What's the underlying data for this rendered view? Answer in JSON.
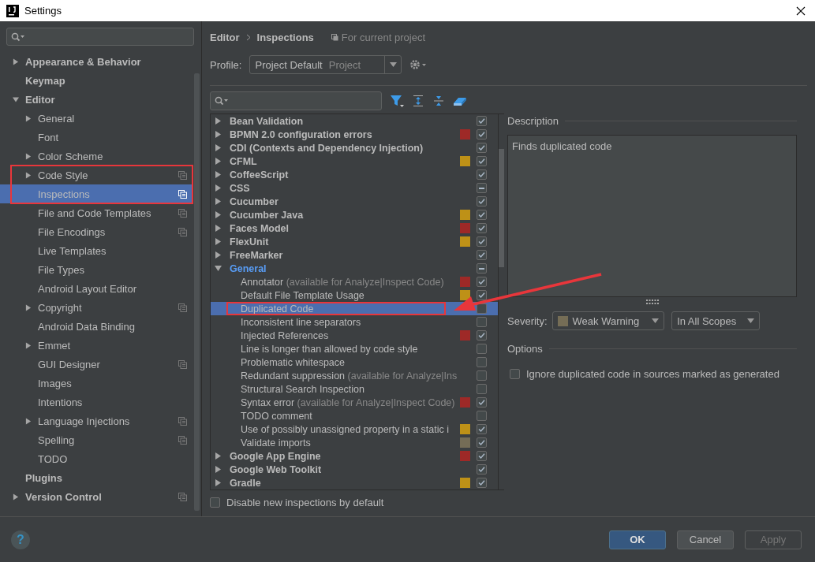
{
  "window": {
    "title": "Settings"
  },
  "sidebar": {
    "items": [
      {
        "name": "Appearance & Behavior",
        "kind": "folder",
        "expanded": false,
        "selected": false,
        "shared": false
      },
      {
        "name": "Keymap",
        "kind": "leaf",
        "selected": false,
        "shared": false
      },
      {
        "name": "Editor",
        "kind": "folder",
        "expanded": true,
        "selected": false,
        "shared": false,
        "children": [
          {
            "name": "General",
            "kind": "folder",
            "expanded": false,
            "selected": false,
            "shared": false
          },
          {
            "name": "Font",
            "kind": "leaf",
            "selected": false,
            "shared": false
          },
          {
            "name": "Color Scheme",
            "kind": "folder",
            "expanded": false,
            "selected": false,
            "shared": false
          },
          {
            "name": "Code Style",
            "kind": "folder",
            "expanded": false,
            "selected": false,
            "shared": true
          },
          {
            "name": "Inspections",
            "kind": "leaf",
            "selected": true,
            "shared": true
          },
          {
            "name": "File and Code Templates",
            "kind": "leaf",
            "selected": false,
            "shared": true
          },
          {
            "name": "File Encodings",
            "kind": "leaf",
            "selected": false,
            "shared": true
          },
          {
            "name": "Live Templates",
            "kind": "leaf",
            "selected": false,
            "shared": false
          },
          {
            "name": "File Types",
            "kind": "leaf",
            "selected": false,
            "shared": false
          },
          {
            "name": "Android Layout Editor",
            "kind": "leaf",
            "selected": false,
            "shared": false
          },
          {
            "name": "Copyright",
            "kind": "folder",
            "expanded": false,
            "selected": false,
            "shared": true
          },
          {
            "name": "Android Data Binding",
            "kind": "leaf",
            "selected": false,
            "shared": false
          },
          {
            "name": "Emmet",
            "kind": "folder",
            "expanded": false,
            "selected": false,
            "shared": false
          },
          {
            "name": "GUI Designer",
            "kind": "leaf",
            "selected": false,
            "shared": true
          },
          {
            "name": "Images",
            "kind": "leaf",
            "selected": false,
            "shared": false
          },
          {
            "name": "Intentions",
            "kind": "leaf",
            "selected": false,
            "shared": false
          },
          {
            "name": "Language Injections",
            "kind": "folder",
            "expanded": false,
            "selected": false,
            "shared": true
          },
          {
            "name": "Spelling",
            "kind": "leaf",
            "selected": false,
            "shared": true
          },
          {
            "name": "TODO",
            "kind": "leaf",
            "selected": false,
            "shared": false
          }
        ]
      },
      {
        "name": "Plugins",
        "kind": "leaf",
        "selected": false,
        "shared": false
      },
      {
        "name": "Version Control",
        "kind": "folder",
        "expanded": false,
        "selected": false,
        "shared": true
      }
    ]
  },
  "header": {
    "breadcrumb": [
      "Editor",
      "Inspections"
    ],
    "scope_note": "For current project"
  },
  "profile": {
    "label": "Profile:",
    "value": "Project Default",
    "value_note": "Project"
  },
  "inspections": [
    {
      "name": "Bean Validation",
      "checked": true,
      "partial": false,
      "expanded": false,
      "modified": false,
      "selected": false
    },
    {
      "name": "BPMN 2.0 configuration errors",
      "color": "#9e2927",
      "checked": true,
      "partial": false,
      "expanded": false,
      "modified": false,
      "selected": false
    },
    {
      "name": "CDI (Contexts and Dependency Injection)",
      "checked": true,
      "partial": false,
      "expanded": false,
      "modified": false,
      "selected": false
    },
    {
      "name": "CFML",
      "color": "#be9117",
      "checked": true,
      "partial": false,
      "expanded": false,
      "modified": false,
      "selected": false
    },
    {
      "name": "CoffeeScript",
      "checked": true,
      "partial": false,
      "expanded": false,
      "modified": false,
      "selected": false
    },
    {
      "name": "CSS",
      "checked": true,
      "partial": true,
      "expanded": false,
      "modified": false,
      "selected": false
    },
    {
      "name": "Cucumber",
      "checked": true,
      "partial": false,
      "expanded": false,
      "modified": false,
      "selected": false
    },
    {
      "name": "Cucumber Java",
      "color": "#be9117",
      "checked": true,
      "partial": false,
      "expanded": false,
      "modified": false,
      "selected": false
    },
    {
      "name": "Faces Model",
      "color": "#9e2927",
      "checked": true,
      "partial": false,
      "expanded": false,
      "modified": false,
      "selected": false
    },
    {
      "name": "FlexUnit",
      "color": "#be9117",
      "checked": true,
      "partial": false,
      "expanded": false,
      "modified": false,
      "selected": false
    },
    {
      "name": "FreeMarker",
      "checked": true,
      "partial": false,
      "expanded": false,
      "modified": false,
      "selected": false
    },
    {
      "name": "General",
      "checked": true,
      "partial": true,
      "expanded": true,
      "modified": true,
      "selected": false,
      "children": [
        {
          "name": "Annotator",
          "note": "(available for Analyze|Inspect Code)",
          "color": "#9e2927",
          "checked": true,
          "selected": false
        },
        {
          "name": "Default File Template Usage",
          "color": "#be9117",
          "checked": true,
          "selected": false
        },
        {
          "name": "Duplicated Code",
          "checked": false,
          "selected": true
        },
        {
          "name": "Inconsistent line separators",
          "checked": false,
          "selected": false
        },
        {
          "name": "Injected References",
          "color": "#9e2927",
          "checked": true,
          "selected": false
        },
        {
          "name": "Line is longer than allowed by code style",
          "checked": false,
          "selected": false
        },
        {
          "name": "Problematic whitespace",
          "checked": false,
          "selected": false
        },
        {
          "name": "Redundant suppression",
          "note": "(available for Analyze|Ins",
          "checked": false,
          "selected": false
        },
        {
          "name": "Structural Search Inspection",
          "checked": false,
          "selected": false
        },
        {
          "name": "Syntax error",
          "note": "(available for Analyze|Inspect Code)",
          "color": "#9e2927",
          "checked": true,
          "selected": false
        },
        {
          "name": "TODO comment",
          "checked": false,
          "selected": false
        },
        {
          "name": "Use of possibly unassigned property in a static i",
          "color": "#be9117",
          "checked": true,
          "selected": false
        },
        {
          "name": "Validate imports",
          "color": "#756d56",
          "checked": true,
          "selected": false
        }
      ]
    },
    {
      "name": "Google App Engine",
      "color": "#9e2927",
      "checked": true,
      "partial": false,
      "expanded": false,
      "modified": false,
      "selected": false
    },
    {
      "name": "Google Web Toolkit",
      "checked": true,
      "partial": false,
      "expanded": false,
      "modified": false,
      "selected": false
    },
    {
      "name": "Gradle",
      "color": "#be9117",
      "checked": true,
      "partial": false,
      "expanded": false,
      "modified": false,
      "selected": false
    }
  ],
  "disable_new": {
    "label": "Disable new inspections by default",
    "checked": false
  },
  "details": {
    "description_heading": "Description",
    "description": "Finds duplicated code",
    "severity_label": "Severity:",
    "severity": {
      "value": "Weak Warning",
      "color": "#756d56"
    },
    "scope": "In All Scopes",
    "options_heading": "Options",
    "options": [
      {
        "label": "Ignore duplicated code in sources marked as generated",
        "checked": false
      }
    ]
  },
  "footer": {
    "help": "?",
    "buttons": [
      {
        "label": "OK",
        "kind": "primary",
        "disabled": false
      },
      {
        "label": "Cancel",
        "kind": "normal",
        "disabled": false
      },
      {
        "label": "Apply",
        "kind": "normal",
        "disabled": true
      }
    ]
  }
}
